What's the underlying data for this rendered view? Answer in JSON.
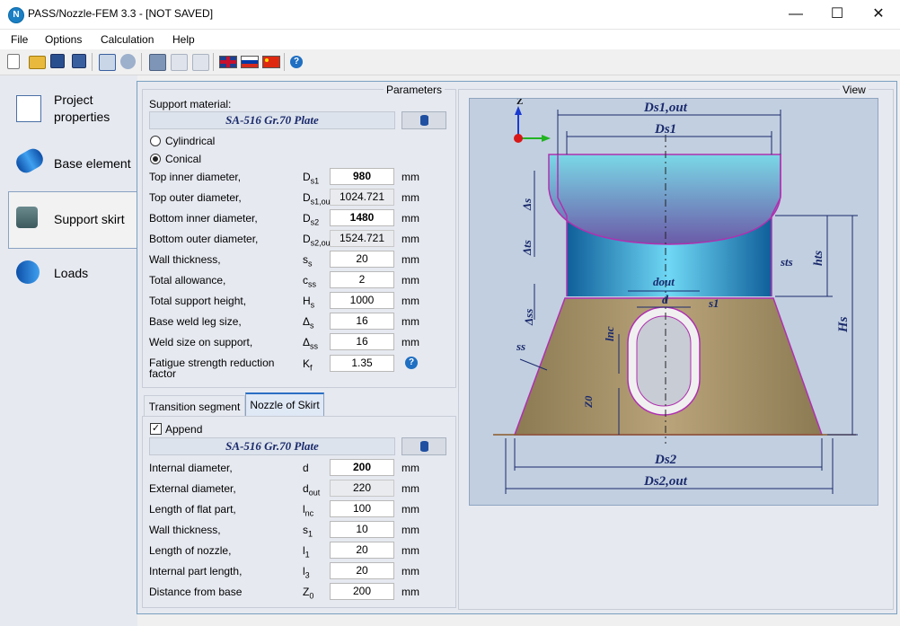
{
  "window": {
    "icon_letter": "N",
    "title": "PASS/Nozzle-FEM 3.3 - [NOT SAVED]",
    "minimize": "—",
    "maximize": "☐",
    "close": "✕"
  },
  "menu": [
    "File",
    "Options",
    "Calculation",
    "Help"
  ],
  "toolbar": {
    "icons": [
      "new-file-icon",
      "open-folder-icon",
      "save-icon",
      "save-as-icon",
      "calc-settings-icon",
      "gears-icon",
      "calculator-icon",
      "report-icon",
      "table-icon",
      "flag-uk-icon",
      "flag-russia-icon",
      "flag-china-icon",
      "help-icon"
    ]
  },
  "nav": {
    "items": [
      {
        "label_line1": "Project",
        "label_line2": "properties",
        "icon": "project-properties-icon"
      },
      {
        "label_line1": "Base element",
        "label_line2": "",
        "icon": "base-element-icon"
      },
      {
        "label_line1": "Support skirt",
        "label_line2": "",
        "icon": "support-skirt-icon"
      },
      {
        "label_line1": "Loads",
        "label_line2": "",
        "icon": "loads-icon"
      }
    ]
  },
  "parameters": {
    "caption": "Parameters",
    "support_material_label": "Support material:",
    "support_material": "SA-516 Gr.70 Plate",
    "shape_cylindrical": "Cylindrical",
    "shape_conical": "Conical",
    "rows": [
      {
        "label": "Top inner diameter,",
        "sym": "D",
        "sub": "s1",
        "value": "980",
        "bold": true,
        "ro": false,
        "unit": "mm"
      },
      {
        "label": "Top outer diameter,",
        "sym": "D",
        "sub": "s1,ou",
        "value": "1024.721",
        "bold": false,
        "ro": true,
        "unit": "mm"
      },
      {
        "label": "Bottom inner diameter,",
        "sym": "D",
        "sub": "s2",
        "value": "1480",
        "bold": true,
        "ro": false,
        "unit": "mm"
      },
      {
        "label": "Bottom outer diameter,",
        "sym": "D",
        "sub": "s2,ou",
        "value": "1524.721",
        "bold": false,
        "ro": true,
        "unit": "mm"
      },
      {
        "label": "Wall thickness,",
        "sym": "s",
        "sub": "s",
        "value": "20",
        "bold": false,
        "ro": false,
        "unit": "mm"
      },
      {
        "label": "Total allowance,",
        "sym": "c",
        "sub": "ss",
        "value": "2",
        "bold": false,
        "ro": false,
        "unit": "mm"
      },
      {
        "label": "Total support height,",
        "sym": "H",
        "sub": "s",
        "value": "1000",
        "bold": false,
        "ro": false,
        "unit": "mm"
      },
      {
        "label": "Base weld leg size,",
        "sym": "Δ",
        "sub": "s",
        "value": "16",
        "bold": false,
        "ro": false,
        "unit": "mm"
      },
      {
        "label": "Weld size on support,",
        "sym": "Δ",
        "sub": "ss",
        "value": "16",
        "bold": false,
        "ro": false,
        "unit": "mm"
      }
    ],
    "fatigue_label_1": "Fatigue strength reduction",
    "fatigue_label_2": "factor",
    "fatigue_sym": "K",
    "fatigue_sub": "f",
    "fatigue_value": "1.35"
  },
  "tabs": {
    "transition": "Transition segment",
    "nozzle": "Nozzle of Skirt"
  },
  "nozzle": {
    "append_label": "Append",
    "append_mark": "✓",
    "material": "SA-516 Gr.70 Plate",
    "rows": [
      {
        "label": "Internal diameter,",
        "sym": "d",
        "sub": "",
        "value": "200",
        "bold": true,
        "ro": false,
        "unit": "mm"
      },
      {
        "label": "External diameter,",
        "sym": "d",
        "sub": "out",
        "value": "220",
        "bold": false,
        "ro": true,
        "unit": "mm"
      },
      {
        "label": "Length of flat part,",
        "sym": "l",
        "sub": "nc",
        "value": "100",
        "bold": false,
        "ro": false,
        "unit": "mm"
      },
      {
        "label": "Wall thickness,",
        "sym": "s",
        "sub": "1",
        "value": "10",
        "bold": false,
        "ro": false,
        "unit": "mm"
      },
      {
        "label": "Length of nozzle,",
        "sym": "l",
        "sub": "1",
        "value": "20",
        "bold": false,
        "ro": false,
        "unit": "mm"
      },
      {
        "label": "Internal part length,",
        "sym": "l",
        "sub": "3",
        "value": "20",
        "bold": false,
        "ro": false,
        "unit": "mm"
      },
      {
        "label": "Distance from base",
        "sym": "Z",
        "sub": "0",
        "value": "200",
        "bold": false,
        "ro": false,
        "unit": "mm"
      }
    ]
  },
  "view": {
    "caption": "View",
    "axis_z": "Z",
    "dims": {
      "ds1_out": "Ds1,out",
      "ds1": "Ds1",
      "delta_s": "Δs",
      "delta_ts": "Δts",
      "hts": "hts",
      "sts": "sts",
      "dout": "dout",
      "d": "d",
      "s1": "s1",
      "delta_ss": "Δss",
      "lnc": "lnc",
      "hs": "Hs",
      "ss": "ss",
      "z0": "Z0",
      "ds2": "Ds2",
      "ds2_out": "Ds2,out"
    }
  }
}
